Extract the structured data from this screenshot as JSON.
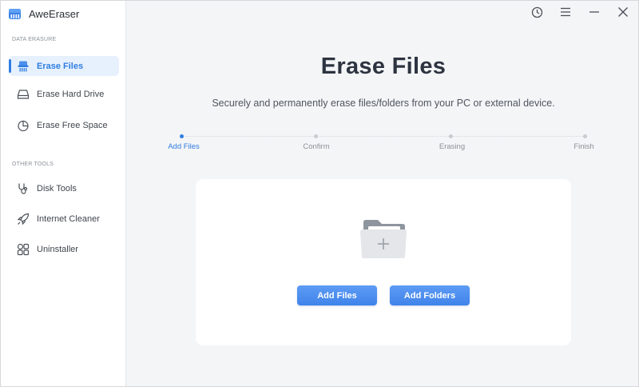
{
  "app": {
    "title": "AweEraser"
  },
  "sidebar": {
    "sections": [
      {
        "label": "DATA ERASURE"
      },
      {
        "label": "OTHER TOOLS"
      }
    ],
    "items": [
      {
        "label": "Erase Files",
        "icon": "shredder-icon",
        "active": true
      },
      {
        "label": "Erase Hard Drive",
        "icon": "hard-drive-icon",
        "active": false
      },
      {
        "label": "Erase Free Space",
        "icon": "pie-chart-icon",
        "active": false
      },
      {
        "label": "Disk Tools",
        "icon": "stethoscope-icon",
        "active": false
      },
      {
        "label": "Internet Cleaner",
        "icon": "rocket-icon",
        "active": false
      },
      {
        "label": "Uninstaller",
        "icon": "apps-grid-icon",
        "active": false
      }
    ]
  },
  "window_controls": [
    "history-icon",
    "menu-icon",
    "minimize-icon",
    "close-icon"
  ],
  "main": {
    "title": "Erase Files",
    "subtitle": "Securely and permanently erase files/folders from your PC or external device."
  },
  "steps": [
    {
      "label": "Add Files",
      "active": true
    },
    {
      "label": "Confirm",
      "active": false
    },
    {
      "label": "Erasing",
      "active": false
    },
    {
      "label": "Finish",
      "active": false
    }
  ],
  "drop_area": {
    "icon": "folder-add-icon",
    "add_files_label": "Add Files",
    "add_folders_label": "Add Folders"
  },
  "colors": {
    "accent": "#2f7de1",
    "button": "#4a8cee",
    "active_nav_bg": "#e7f1fd",
    "main_bg": "#f4f5f7"
  }
}
